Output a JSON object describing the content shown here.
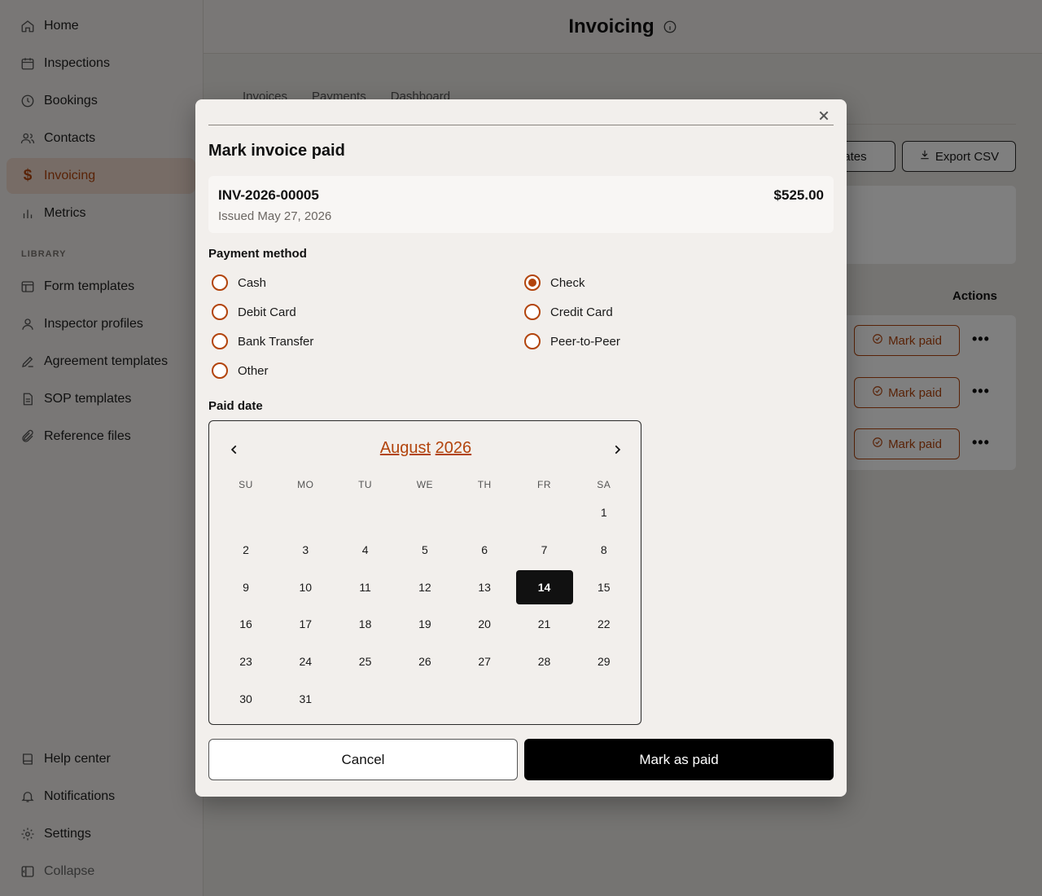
{
  "sidebar": {
    "items": [
      {
        "label": "Home",
        "icon": "home-icon"
      },
      {
        "label": "Inspections",
        "icon": "calendar-icon"
      },
      {
        "label": "Bookings",
        "icon": "clock-icon"
      },
      {
        "label": "Contacts",
        "icon": "users-icon"
      },
      {
        "label": "Invoicing",
        "icon": "dollar-icon",
        "active": true
      },
      {
        "label": "Metrics",
        "icon": "bar-chart-icon"
      }
    ],
    "library_label": "LIBRARY",
    "library_items": [
      {
        "label": "Form templates",
        "icon": "layout-icon"
      },
      {
        "label": "Inspector profiles",
        "icon": "user-icon"
      },
      {
        "label": "Agreement templates",
        "icon": "signature-icon"
      },
      {
        "label": "SOP templates",
        "icon": "document-icon"
      },
      {
        "label": "Reference files",
        "icon": "paperclip-icon"
      }
    ],
    "bottom_items": [
      {
        "label": "Help center",
        "icon": "book-icon"
      },
      {
        "label": "Notifications",
        "icon": "bell-icon"
      },
      {
        "label": "Settings",
        "icon": "gear-icon"
      },
      {
        "label": "Collapse",
        "icon": "sidebar-collapse-icon"
      }
    ]
  },
  "header": {
    "title": "Invoicing"
  },
  "background": {
    "tabs": [
      "Invoices",
      "Payments",
      "Dashboard"
    ],
    "dates_button": "Dates",
    "export_button": "Export CSV",
    "actions_header": "Actions",
    "row_button_label": "Mark paid",
    "row_more": "•••"
  },
  "modal": {
    "close": "×",
    "title": "Mark invoice paid",
    "invoice_number": "INV-2026-00005",
    "invoice_amount": "$525.00",
    "issued": "Issued May 27, 2026",
    "payment_method_label": "Payment method",
    "payment_methods_left": [
      {
        "label": "Cash",
        "selected": false
      },
      {
        "label": "Debit Card",
        "selected": false
      },
      {
        "label": "Bank Transfer",
        "selected": false
      },
      {
        "label": "Other",
        "selected": false
      }
    ],
    "payment_methods_right": [
      {
        "label": "Check",
        "selected": true
      },
      {
        "label": "Credit Card",
        "selected": false
      },
      {
        "label": "Peer-to-Peer",
        "selected": false
      }
    ],
    "paid_date_label": "Paid date",
    "calendar": {
      "month": "August",
      "year": "2026",
      "weekdays": [
        "SU",
        "MO",
        "TU",
        "WE",
        "TH",
        "FR",
        "SA"
      ],
      "first_weekday_index": 6,
      "days_in_month": 31,
      "selected_day": 14
    },
    "cancel_label": "Cancel",
    "submit_label": "Mark as paid"
  },
  "colors": {
    "accent": "#b2440c",
    "primary_button": "#000000"
  }
}
